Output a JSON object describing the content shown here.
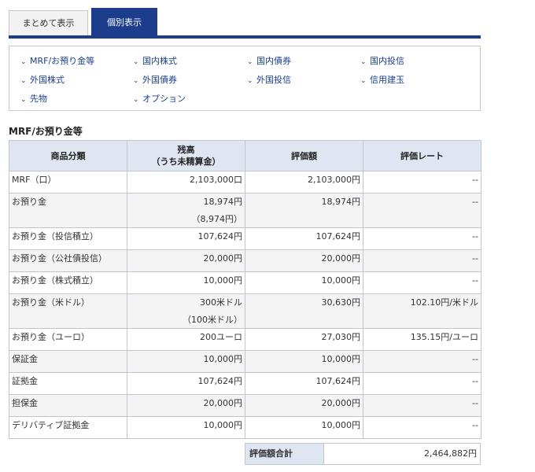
{
  "tabs": [
    {
      "label": "まとめて表示",
      "active": false
    },
    {
      "label": "個別表示",
      "active": true
    }
  ],
  "nav_links": [
    "MRF/お預り金等",
    "国内株式",
    "国内債券",
    "国内投信",
    "外国株式",
    "外国債券",
    "外国投信",
    "信用建玉",
    "先物",
    "オプション"
  ],
  "section_title": "MRF/お預り金等",
  "table": {
    "headers": [
      "商品分類",
      "残高",
      "（うち未精算金）",
      "評価額",
      "評価レート"
    ],
    "rows": [
      {
        "category": "MRF（口）",
        "balance": "2,103,000口",
        "balance_sub": "",
        "value": "2,103,000円",
        "rate": "--"
      },
      {
        "category": "お預り金",
        "balance": "18,974円",
        "balance_sub": "（8,974円）",
        "value": "18,974円",
        "rate": "--"
      },
      {
        "category": "お預り金（投信積立）",
        "balance": "107,624円",
        "balance_sub": "",
        "value": "107,624円",
        "rate": "--"
      },
      {
        "category": "お預り金（公社債投信）",
        "balance": "20,000円",
        "balance_sub": "",
        "value": "20,000円",
        "rate": "--"
      },
      {
        "category": "お預り金（株式積立）",
        "balance": "10,000円",
        "balance_sub": "",
        "value": "10,000円",
        "rate": "--"
      },
      {
        "category": "お預り金（米ドル）",
        "balance": "300米ドル",
        "balance_sub": "（100米ドル）",
        "value": "30,630円",
        "rate": "102.10円/米ドル"
      },
      {
        "category": "お預り金（ユーロ）",
        "balance": "200ユーロ",
        "balance_sub": "",
        "value": "27,030円",
        "rate": "135.15円/ユーロ"
      },
      {
        "category": "保証金",
        "balance": "10,000円",
        "balance_sub": "",
        "value": "10,000円",
        "rate": "--"
      },
      {
        "category": "証拠金",
        "balance": "107,624円",
        "balance_sub": "",
        "value": "107,624円",
        "rate": "--"
      },
      {
        "category": "担保金",
        "balance": "20,000円",
        "balance_sub": "",
        "value": "20,000円",
        "rate": "--"
      },
      {
        "category": "デリバティブ証拠金",
        "balance": "10,000円",
        "balance_sub": "",
        "value": "10,000円",
        "rate": "--"
      }
    ]
  },
  "total": {
    "label": "評価額合計",
    "value": "2,464,882円"
  },
  "colors": {
    "accent": "#1c3c8c",
    "header_bg": "#dfe6f2",
    "link": "#1a3f8c"
  }
}
